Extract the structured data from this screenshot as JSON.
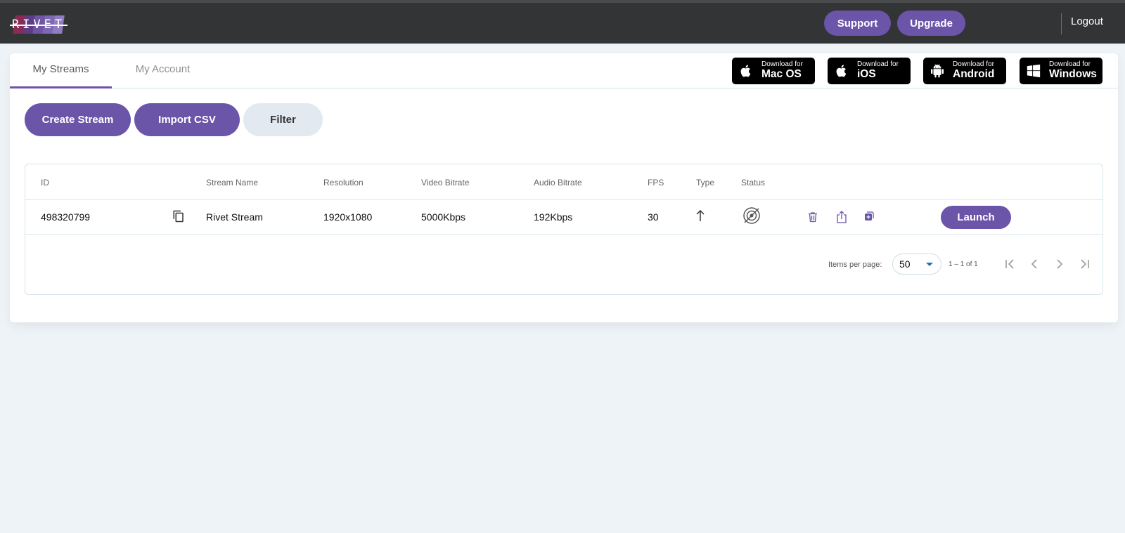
{
  "header": {
    "logo_text": "RIVET",
    "support_label": "Support",
    "upgrade_label": "Upgrade",
    "logout_label": "Logout"
  },
  "tabs": [
    {
      "label": "My Streams",
      "active": true
    },
    {
      "label": "My Account",
      "active": false
    }
  ],
  "downloads": [
    {
      "small": "Download for",
      "big": "Mac OS",
      "icon": "apple-icon"
    },
    {
      "small": "Download for",
      "big": "iOS",
      "icon": "apple-icon"
    },
    {
      "small": "Download for",
      "big": "Android",
      "icon": "android-icon"
    },
    {
      "small": "Download for",
      "big": "Windows",
      "icon": "windows-icon"
    }
  ],
  "actions": {
    "create_label": "Create Stream",
    "import_label": "Import CSV",
    "filter_label": "Filter"
  },
  "table": {
    "columns": [
      "ID",
      "Stream Name",
      "Resolution",
      "Video Bitrate",
      "Audio Bitrate",
      "FPS",
      "Type",
      "Status"
    ],
    "rows": [
      {
        "id": "498320799",
        "name": "Rivet Stream",
        "resolution": "1920x1080",
        "video_bitrate": "5000Kbps",
        "audio_bitrate": "192Kbps",
        "fps": "30",
        "type_icon": "arrow-up-icon",
        "status_icon": "broadcast-off-icon",
        "launch_label": "Launch"
      }
    ]
  },
  "pagination": {
    "items_per_page_label": "Items per page:",
    "items_per_page_value": "50",
    "range_label": "1 – 1 of 1"
  },
  "colors": {
    "accent": "#6b55a8",
    "topbar": "#333436",
    "page_bg": "#edf3f6",
    "filter_bg": "#e3e9f1"
  }
}
